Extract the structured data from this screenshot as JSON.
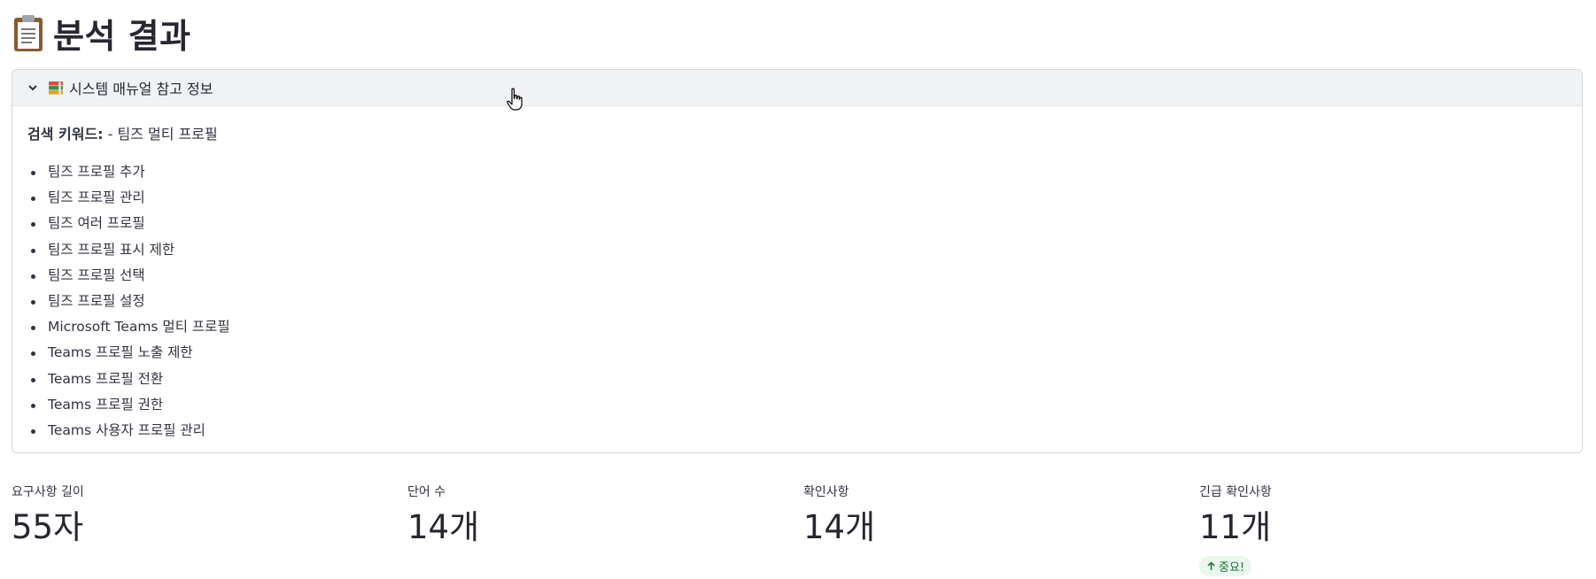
{
  "header": {
    "title": "분석 결과",
    "icon": "clipboard-icon"
  },
  "expander": {
    "title": "시스템 매뉴얼 참고 정보",
    "icon": "books-icon",
    "expanded": true,
    "keywords_label": "검색 키워드:",
    "keywords_inline": "- 팀즈 멀티 프로필",
    "items": [
      "팀즈 프로필 추가",
      "팀즈 프로필 관리",
      "팀즈 여러 프로필",
      "팀즈 프로필 표시 제한",
      "팀즈 프로필 선택",
      "팀즈 프로필 설정",
      "Microsoft Teams 멀티 프로필",
      "Teams 프로필 노출 제한",
      "Teams 프로필 전환",
      "Teams 프로필 권한",
      "Teams 사용자 프로필 관리"
    ]
  },
  "metrics": [
    {
      "label": "요구사항 길이",
      "value": "55자"
    },
    {
      "label": "단어 수",
      "value": "14개"
    },
    {
      "label": "확인사항",
      "value": "14개"
    },
    {
      "label": "긴급 확인사항",
      "value": "11개",
      "delta": "중요!",
      "delta_color": "#177233",
      "delta_bg": "#e9f7ec"
    }
  ],
  "colors": {
    "expander_header_bg": "#f0f2f6",
    "text": "#31333f"
  }
}
